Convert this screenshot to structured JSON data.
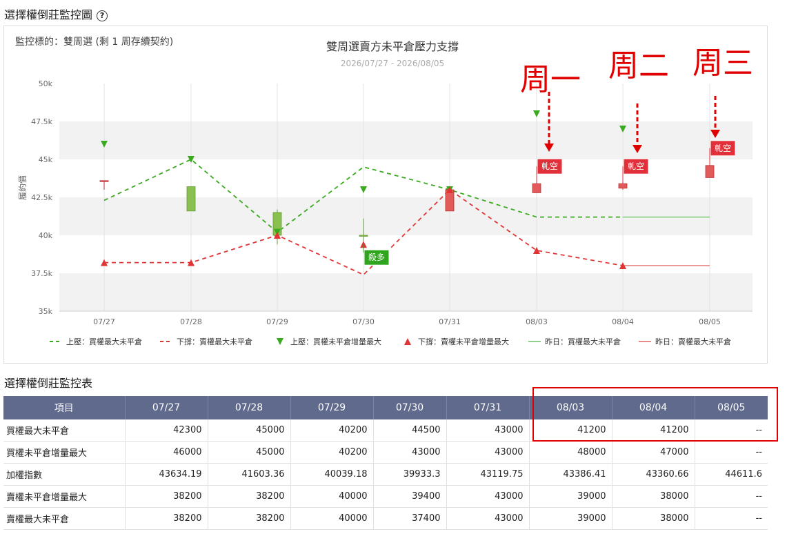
{
  "page": {
    "section_title": "選擇權倒莊監控圖",
    "help_icon": "?",
    "table_title": "選擇權倒莊監控表"
  },
  "colors": {
    "upper": "#3aaa1e",
    "lower": "#e03535",
    "yesterday_upper": "#8fd08a",
    "yesterday_lower": "#e88a8a",
    "candle_green": "#8ac04f",
    "candle_red": "#e25a5a",
    "header_bg": "#5f6a8c",
    "annotation": "#e00000"
  },
  "chart_data": {
    "type": "line",
    "subject_label": "監控標的：雙周選 (剩 1 周存續契約)",
    "title": "雙周選賣方未平倉壓力支撐",
    "subtitle": "2026/07/27 - 2026/08/05",
    "ylabel": "履約價",
    "ylim": [
      35000,
      50000
    ],
    "yticks": [
      35000,
      37500,
      40000,
      42500,
      45000,
      47500,
      50000
    ],
    "ytick_labels": [
      "35k",
      "37.5k",
      "40k",
      "42.5k",
      "45k",
      "47.5k",
      "50k"
    ],
    "categories": [
      "07/27",
      "07/28",
      "07/29",
      "07/30",
      "07/31",
      "08/03",
      "08/04",
      "08/05"
    ],
    "series": [
      {
        "name": "上壓：買權最大未平倉",
        "kind": "dashed-line",
        "color": "#3aaa1e",
        "values": [
          42300,
          45000,
          40200,
          44500,
          43000,
          41200,
          41200,
          null
        ]
      },
      {
        "name": "下撐：賣權最大未平倉",
        "kind": "dashed-line",
        "color": "#e03535",
        "values": [
          38200,
          38200,
          40000,
          37400,
          43000,
          39000,
          38000,
          null
        ]
      },
      {
        "name": "上壓：買權未平倉增量最大",
        "kind": "triangle-down",
        "color": "#3aaa1e",
        "values": [
          46000,
          45000,
          40200,
          43000,
          43000,
          48000,
          47000,
          null
        ]
      },
      {
        "name": "下撐：賣權未平倉增量最大",
        "kind": "triangle-up",
        "color": "#e03535",
        "values": [
          38200,
          38200,
          40000,
          39400,
          43000,
          39000,
          38000,
          null
        ]
      },
      {
        "name": "昨日：買權最大未平倉",
        "kind": "solid-line",
        "color": "#8fd08a",
        "values": [
          null,
          null,
          null,
          null,
          null,
          null,
          41200,
          41200
        ]
      },
      {
        "name": "昨日：賣權最大未平倉",
        "kind": "solid-line",
        "color": "#e88a8a",
        "values": [
          null,
          null,
          null,
          null,
          null,
          null,
          38000,
          38000
        ]
      }
    ],
    "candles": [
      {
        "x": "07/27",
        "open": 43600,
        "close": 43600,
        "high": 43600,
        "low": 43000,
        "color": "red"
      },
      {
        "x": "07/28",
        "open": 43200,
        "close": 41600,
        "high": 43200,
        "low": 41600,
        "color": "green"
      },
      {
        "x": "07/29",
        "open": 41500,
        "close": 40000,
        "high": 41700,
        "low": 39400,
        "color": "green"
      },
      {
        "x": "07/30",
        "open": 40000,
        "close": 40000,
        "high": 41100,
        "low": 39500,
        "color": "green"
      },
      {
        "x": "07/31",
        "open": 43000,
        "close": 41600,
        "high": 43100,
        "low": 41600,
        "color": "red"
      },
      {
        "x": "08/03",
        "open": 42800,
        "close": 43400,
        "high": 43400,
        "low": 42800,
        "color": "red"
      },
      {
        "x": "08/04",
        "open": 43100,
        "close": 43400,
        "high": 43400,
        "low": 43000,
        "color": "red"
      },
      {
        "x": "08/05",
        "open": 43800,
        "close": 44600,
        "high": 44600,
        "low": 43800,
        "color": "red"
      }
    ],
    "flags": [
      {
        "x": "07/30",
        "y": 39400,
        "text": "殺多",
        "color": "green"
      },
      {
        "x": "08/03",
        "y": 43400,
        "text": "軋空",
        "color": "red"
      },
      {
        "x": "08/04",
        "y": 43400,
        "text": "軋空",
        "color": "red"
      },
      {
        "x": "08/05",
        "y": 44600,
        "text": "軋空",
        "color": "red"
      }
    ],
    "annotations": [
      {
        "x": "08/03",
        "text": "周一"
      },
      {
        "x": "08/04",
        "text": "周二"
      },
      {
        "x": "08/05",
        "text": "周三"
      }
    ],
    "grid": "alternating horizontal bands",
    "legend_position": "bottom"
  },
  "table": {
    "headers": [
      "項目",
      "07/27",
      "07/28",
      "07/29",
      "07/30",
      "07/31",
      "08/03",
      "08/04",
      "08/05"
    ],
    "rows": [
      [
        "買權最大未平倉",
        "42300",
        "45000",
        "40200",
        "44500",
        "43000",
        "41200",
        "41200",
        "--"
      ],
      [
        "買權未平倉增量最大",
        "46000",
        "45000",
        "40200",
        "43000",
        "43000",
        "48000",
        "47000",
        "--"
      ],
      [
        "加權指數",
        "43634.19",
        "41603.36",
        "40039.18",
        "39933.3",
        "43119.75",
        "43386.41",
        "43360.66",
        "44611.6"
      ],
      [
        "賣權未平倉增量最大",
        "38200",
        "38200",
        "40000",
        "39400",
        "43000",
        "39000",
        "38000",
        "--"
      ],
      [
        "賣權最大未平倉",
        "38200",
        "38200",
        "40000",
        "37400",
        "43000",
        "39000",
        "38000",
        "--"
      ]
    ]
  }
}
